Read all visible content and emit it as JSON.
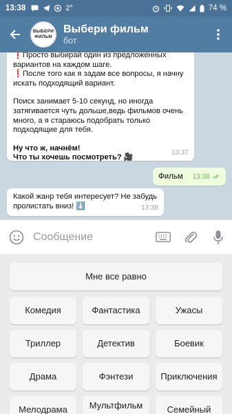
{
  "status_bar": {
    "time": "13:38",
    "temperature": "2°",
    "battery": "74 %"
  },
  "header": {
    "title": "Выбери фильм",
    "subtitle": "бот",
    "avatar_text_top": "ВЫБЕРИ",
    "avatar_text_bottom": "ФИЛЬМ"
  },
  "messages": {
    "bot_intro": {
      "line1": "❗Просто выбирай один из предложенных вариантов на каждом шаге.",
      "line2": "❗После того как я задам все вопросы, я начну искать подходящий вариант.",
      "line3": "Поиск занимает 5-10 секунд, но иногда затягивается чуть дольше,ведь фильмов очень много, а я стараюсь подобрать только подходящие для тебя.",
      "line4": "Ну что ж, начнём!",
      "line5": "Что ты хочешь посмотреть? 🎥",
      "time": "13:37"
    },
    "user_reply": {
      "text": "Фильм",
      "time": "13:38"
    },
    "bot_question": {
      "text": "Какой жанр тебя интересует? Не забудь пролистать вниз! ⬇️",
      "time": "13:38"
    }
  },
  "input": {
    "placeholder": "Сообщение"
  },
  "keyboard": {
    "any": "Мне все равно",
    "row1": [
      "Комедия",
      "Фантастика",
      "Ужасы"
    ],
    "row2": [
      "Триллер",
      "Детектив",
      "Боевик"
    ],
    "row3": [
      "Драма",
      "Фэнтези",
      "Приключения"
    ],
    "row4": [
      "Мелодрама",
      "Мультфильм",
      "Семейный"
    ]
  },
  "colors": {
    "header": "#527da3",
    "status": "#4a7296",
    "outgoing": "#effdde",
    "keyboard_bg": "#e9ebed"
  }
}
